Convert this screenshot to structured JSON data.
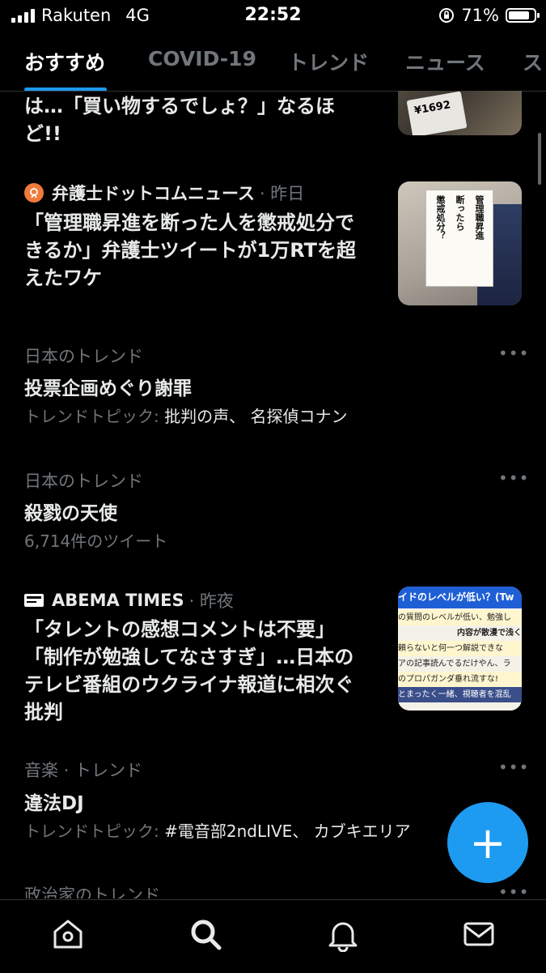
{
  "status_bar": {
    "carrier": "Rakuten",
    "network": "4G",
    "time": "22:52",
    "battery": "71%",
    "icons": [
      "signal-icon",
      "orientation-lock-icon",
      "battery-icon"
    ]
  },
  "tabs": [
    {
      "label": "おすすめ",
      "active": true
    },
    {
      "label": "COVID-19"
    },
    {
      "label": "トレンド"
    },
    {
      "label": "ニュース"
    },
    {
      "label": "ス"
    }
  ],
  "feed": {
    "news1": {
      "lines": [
        "は…「買い物するでしょ？」なるほ",
        "ど!!"
      ],
      "thumb_price": "¥1692"
    },
    "news2": {
      "source": "弁護士ドットコムニュース",
      "time": "· 昨日",
      "lines": [
        "「管理職昇進を断った人を懲戒処分で",
        "きるか」弁護士ツイートが1万RTを超",
        "えたワケ"
      ],
      "thumb_sign": [
        "管理職昇進",
        "断ったら",
        "懲戒処分？"
      ]
    },
    "trend1": {
      "context": "日本のトレンド",
      "title": "投票企画めぐり謝罪",
      "meta_label": "トレンドトピック:",
      "meta_value": "批判の声、 名探偵コナン"
    },
    "trend2": {
      "context": "日本のトレンド",
      "title": "殺戮の天使",
      "meta": "6,714件のツイート"
    },
    "news3": {
      "source": "ABEMA TIMES",
      "time": "· 昨夜",
      "lines": [
        "「タレントの感想コメントは不要」",
        "「制作が勉強してなさすぎ」…日本の",
        "テレビ番組のウクライナ報道に相次ぐ",
        "批判"
      ],
      "thumb_lines": [
        "イドのレベルが低い？(Tw",
        "の質問のレベルが低い、勉強し",
        "内容が散漫で浅く",
        "頼らないと何一つ解説できな",
        "アの記事読んでるだけやん、ラ",
        "のプロパガンダ垂れ流すな!",
        "とまったく一緒、視聴者を混乱"
      ]
    },
    "trend3": {
      "context": "音楽 · トレンド",
      "title": "違法DJ",
      "meta_label": "トレンドトピック:",
      "meta_value": "#電音部2ndLIVE、 カブキエリア"
    },
    "trend4": {
      "context": "政治家のトレンド"
    },
    "more_label": "•••"
  },
  "fab_label": "+",
  "nav": [
    "home-icon",
    "search-icon",
    "notifications-icon",
    "messages-icon"
  ],
  "colors": {
    "accent": "#1d9bf0",
    "background": "#000000",
    "secondary_text": "#71767b"
  }
}
